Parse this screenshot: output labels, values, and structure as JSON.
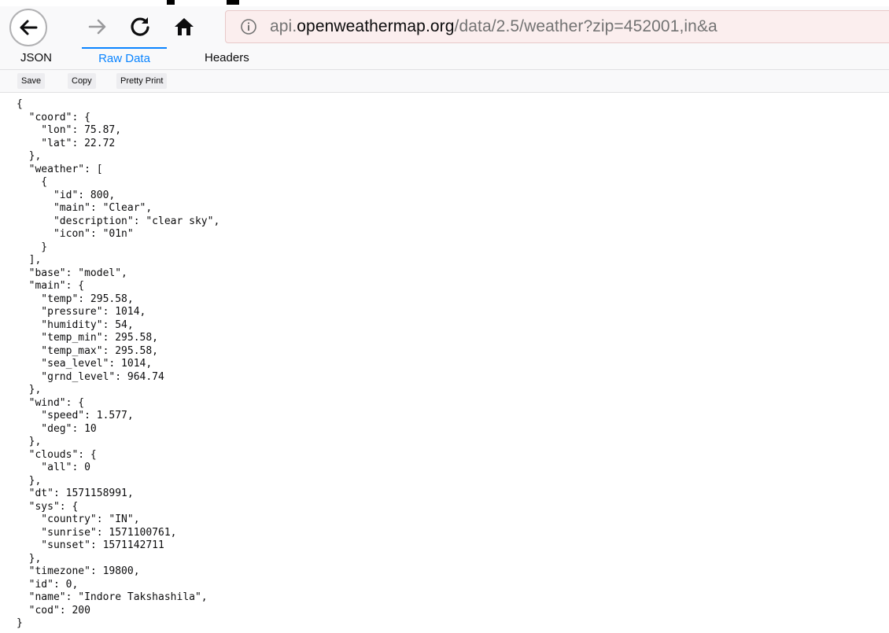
{
  "nav": {
    "back_icon": "back-arrow-icon",
    "forward_icon": "forward-arrow-icon",
    "reload_icon": "reload-icon",
    "home_icon": "home-icon"
  },
  "url": {
    "prefix": "api.",
    "host": "openweathermap.org",
    "path": "/data/2.5/weather?zip=452001,in&a"
  },
  "tabs": [
    "JSON",
    "Raw Data",
    "Headers"
  ],
  "selected_tab": "Raw Data",
  "toolbar": {
    "save_label": "Save",
    "copy_label": "Copy",
    "pretty_label": "Pretty Print"
  },
  "raw_text": "{\n  \"coord\": {\n    \"lon\": 75.87,\n    \"lat\": 22.72\n  },\n  \"weather\": [\n    {\n      \"id\": 800,\n      \"main\": \"Clear\",\n      \"description\": \"clear sky\",\n      \"icon\": \"01n\"\n    }\n  ],\n  \"base\": \"model\",\n  \"main\": {\n    \"temp\": 295.58,\n    \"pressure\": 1014,\n    \"humidity\": 54,\n    \"temp_min\": 295.58,\n    \"temp_max\": 295.58,\n    \"sea_level\": 1014,\n    \"grnd_level\": 964.74\n  },\n  \"wind\": {\n    \"speed\": 1.577,\n    \"deg\": 10\n  },\n  \"clouds\": {\n    \"all\": 0\n  },\n  \"dt\": 1571158991,\n  \"sys\": {\n    \"country\": \"IN\",\n    \"sunrise\": 1571100761,\n    \"sunset\": 1571142711\n  },\n  \"timezone\": 19800,\n  \"id\": 0,\n  \"name\": \"Indore Takshashila\",\n  \"cod\": 200\n}",
  "colors": {
    "selected_tab": "#0a84ff",
    "urlbar_bg": "#fbeeee"
  }
}
